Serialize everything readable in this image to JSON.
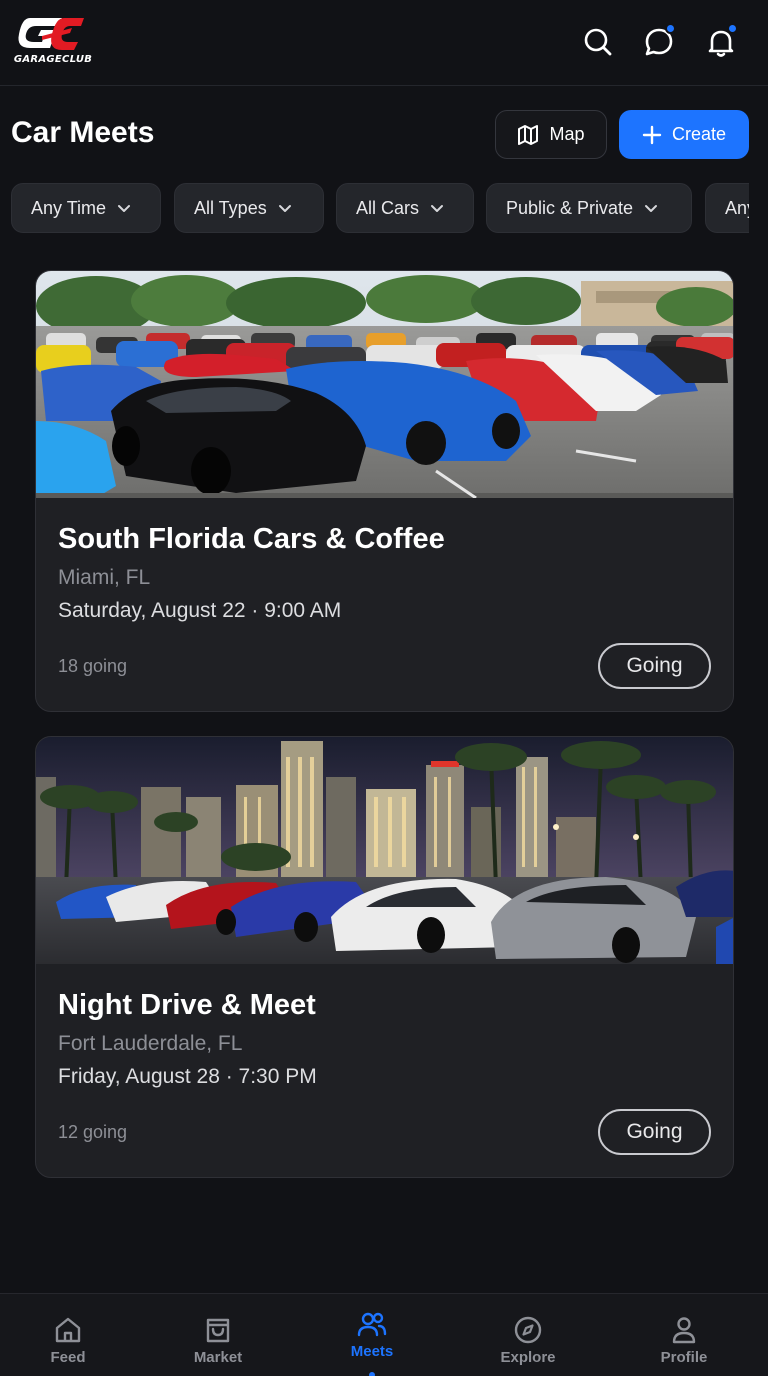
{
  "app": {
    "logo_text": "GARAGECLUB",
    "accent_color": "#1d74ff",
    "logo_red": "#e21b23"
  },
  "header": {
    "icons": [
      "search-icon",
      "chat-icon",
      "bell-icon"
    ],
    "chat_has_unread": true,
    "notifications_has_unread": true
  },
  "page": {
    "title": "Car Meets",
    "map_label": "Map",
    "create_label": "Create"
  },
  "filters": [
    {
      "label": "Any Time"
    },
    {
      "label": "All Types"
    },
    {
      "label": "All Cars"
    },
    {
      "label": "Public & Private"
    },
    {
      "label": "Any"
    }
  ],
  "meets": [
    {
      "title": "South Florida Cars & Coffee",
      "location": "Miami, FL",
      "date": "Saturday, August 22 · 9:00 AM",
      "going_count": "18 going",
      "rsvp_label": "Going",
      "image": "daytime parking lot car meet"
    },
    {
      "title": "Night Drive & Meet",
      "location": "Fort Lauderdale, FL",
      "date": "Friday, August 28 · 7:30 PM",
      "going_count": "12 going",
      "rsvp_label": "Going",
      "image": "night city skyline car meet"
    }
  ],
  "nav": {
    "items": [
      {
        "label": "Feed",
        "icon": "home-icon"
      },
      {
        "label": "Market",
        "icon": "shopping-bag-icon"
      },
      {
        "label": "Meets",
        "icon": "users-icon",
        "active": true
      },
      {
        "label": "Explore",
        "icon": "compass-icon"
      },
      {
        "label": "Profile",
        "icon": "user-icon"
      }
    ]
  }
}
